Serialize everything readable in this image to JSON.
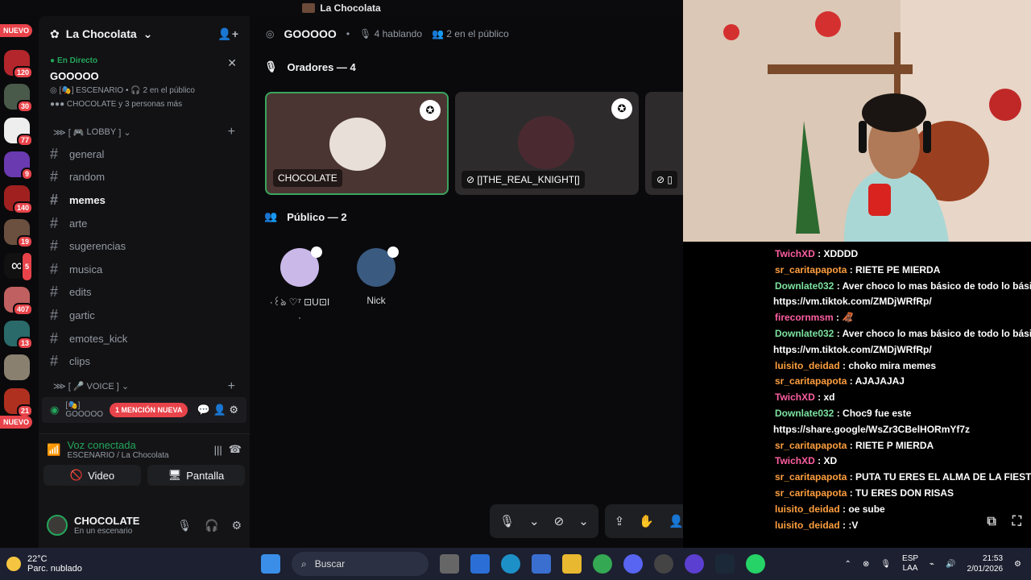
{
  "window": {
    "title": "La Chocolata"
  },
  "rail": {
    "nuevo_top": "NUEVO",
    "nuevo_bottom": "NUEVO",
    "counts": [
      "120",
      "30",
      "77",
      "9",
      "140",
      "19",
      "5",
      "407",
      "13",
      "21"
    ]
  },
  "server": {
    "name": "La Chocolata"
  },
  "live": {
    "tag": "En Directo",
    "title": "GOOOOO",
    "stage_line": "ESCENARIO",
    "audience_line": "2 en el público",
    "people_line": "CHOCOLATE y 3 personas más"
  },
  "categories": {
    "lobby": "LOBBY",
    "voice": "VOICE"
  },
  "channels": [
    {
      "name": "general",
      "bold": false
    },
    {
      "name": "random",
      "bold": false
    },
    {
      "name": "memes",
      "bold": true
    },
    {
      "name": "arte",
      "bold": false
    },
    {
      "name": "sugerencias",
      "bold": false
    },
    {
      "name": "musica",
      "bold": false
    },
    {
      "name": "edits",
      "bold": false
    },
    {
      "name": "gartic",
      "bold": false
    },
    {
      "name": "emotes_kick",
      "bold": false
    },
    {
      "name": "clips",
      "bold": false
    }
  ],
  "voice_channel": {
    "sub": "GOOOOO",
    "mention": "1 MENCIÓN NUEVA"
  },
  "voice_panel": {
    "status": "Voz conectada",
    "location": "ESCENARIO / La Chocolata",
    "video_label": "Video",
    "screen_label": "Pantalla"
  },
  "user": {
    "name": "CHOCOLATE",
    "status": "En un escenario"
  },
  "stage": {
    "title": "GOOOOO",
    "speaking": "4 hablando",
    "audience": "2 en el público",
    "speakers_header": "Oradores — 4",
    "audience_header": "Público — 2",
    "speakers": [
      "CHOCOLATE",
      "[]THE_REAL_KNIGHT[]"
    ],
    "audience_members": [
      "Nick"
    ]
  },
  "chat": [
    {
      "user": "TwichXD",
      "color": "#ff5fa2",
      "text": "XDDDD"
    },
    {
      "user": "sr_caritapapota",
      "color": "#ff9f3f",
      "text": "RIETE PE MIERDA"
    },
    {
      "user": "Downlate032",
      "color": "#7de3a0",
      "text": "Aver choco lo mas básico de todo lo básico"
    },
    {
      "user": "",
      "color": "#ffffff",
      "text": "https://vm.tiktok.com/ZMDjWRfRp/"
    },
    {
      "user": "firecornmsm",
      "color": "#ff5fa2",
      "text": "🦧"
    },
    {
      "user": "Downlate032",
      "color": "#7de3a0",
      "text": "Aver choco lo mas básico de todo lo básico"
    },
    {
      "user": "",
      "color": "#ffffff",
      "text": "https://vm.tiktok.com/ZMDjWRfRp/"
    },
    {
      "user": "luisito_deidad",
      "color": "#ff9f3f",
      "text": "choko mira memes"
    },
    {
      "user": "sr_caritapapota",
      "color": "#ff9f3f",
      "text": "AJAJAJAJ"
    },
    {
      "user": "TwichXD",
      "color": "#ff5fa2",
      "text": "xd"
    },
    {
      "user": "Downlate032",
      "color": "#7de3a0",
      "text": "Choc9 fue este"
    },
    {
      "user": "",
      "color": "#ffffff",
      "text": "https://share.google/WsZr3CBelHORmYf7z"
    },
    {
      "user": "sr_caritapapota",
      "color": "#ff9f3f",
      "text": "RIETE P MIERDA"
    },
    {
      "user": "TwichXD",
      "color": "#ff5fa2",
      "text": "XD"
    },
    {
      "user": "sr_caritapapota",
      "color": "#ff9f3f",
      "text": "PUTA TU ERES EL ALMA DE LA FIESTA"
    },
    {
      "user": "sr_caritapapota",
      "color": "#ff9f3f",
      "text": "TU ERES DON RISAS"
    },
    {
      "user": "luisito_deidad",
      "color": "#ff9f3f",
      "text": "oe sube"
    },
    {
      "user": "luisito_deidad",
      "color": "#ff9f3f",
      "text": ":V"
    }
  ],
  "taskbar": {
    "temp": "22°C",
    "weather": "Parc. nublado",
    "search": "Buscar",
    "lang1": "ESP",
    "lang2": "LAA",
    "time": "21:53",
    "date": "2/01/2026"
  },
  "colors": {
    "accent_red": "#e8434a",
    "online_green": "#23a55a",
    "bg": "#0a0a0c"
  }
}
